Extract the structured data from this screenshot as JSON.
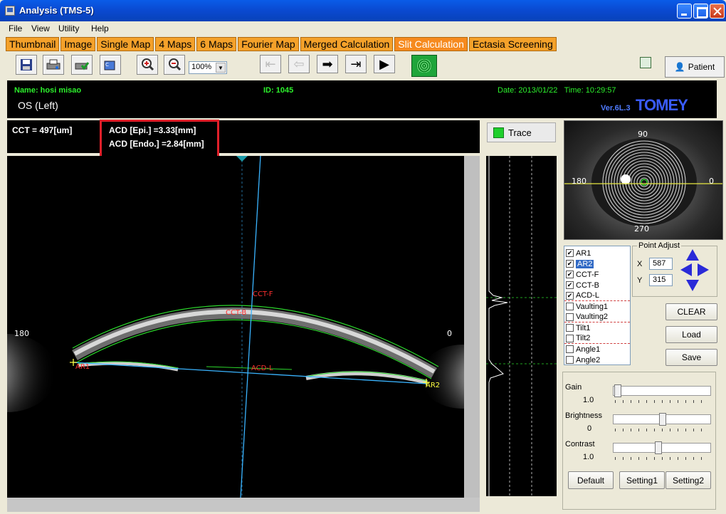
{
  "window": {
    "title": "Analysis (TMS-5)"
  },
  "menu": [
    "File",
    "View",
    "Utility",
    "Help"
  ],
  "tabs": [
    "Thumbnail",
    "Image",
    "Single Map",
    "4 Maps",
    "6 Maps",
    "Fourier Map",
    "Merged Calculation",
    "Slit Calculation",
    "Ectasia Screening"
  ],
  "active_tab": "Slit Calculation",
  "toolbar": {
    "zoom": "100%",
    "patient_label": "Patient"
  },
  "patient": {
    "name": "Name: hosi misao",
    "id": "ID: 1045",
    "eye": "OS (Left)",
    "date": "Date: 2013/01/22",
    "time": "Time: 10:29:57",
    "version": "Ver.6L.3",
    "brand": "TOMEY"
  },
  "measurements": {
    "cct": "CCT = 497[um]",
    "acd_epi": "ACD [Epi.]  =3.33[mm]",
    "acd_endo": "ACD [Endo.] =2.84[mm]"
  },
  "slit_image": {
    "label_left": "180",
    "label_right": "0",
    "markers": [
      "CCT-F",
      "CCT-B",
      "ACD-L",
      "AR1",
      "AR2"
    ]
  },
  "trace": {
    "label": "Trace"
  },
  "eye_thumb": {
    "label_top": "90",
    "label_left": "180",
    "label_right": "0",
    "label_bottom": "270"
  },
  "points": [
    {
      "label": "AR1",
      "checked": true
    },
    {
      "label": "AR2",
      "checked": true,
      "selected": true
    },
    {
      "label": "CCT-F",
      "checked": true
    },
    {
      "label": "CCT-B",
      "checked": true
    },
    {
      "label": "ACD-L",
      "checked": true
    },
    {
      "label": "Vaulting1",
      "checked": false
    },
    {
      "label": "Vaulting2",
      "checked": false
    },
    {
      "label": "Tilt1",
      "checked": false
    },
    {
      "label": "Tilt2",
      "checked": false
    },
    {
      "label": "Angle1",
      "checked": false
    },
    {
      "label": "Angle2",
      "checked": false
    }
  ],
  "point_adjust": {
    "title": "Point Adjust",
    "x_label": "X",
    "y_label": "Y",
    "x": "587",
    "y": "315"
  },
  "buttons": {
    "clear": "CLEAR",
    "load": "Load",
    "save": "Save",
    "default": "Default",
    "setting1": "Setting1",
    "setting2": "Setting2"
  },
  "sliders": [
    {
      "label": "Gain",
      "value": "1.0",
      "level": 0.0
    },
    {
      "label": "Brightness",
      "value": "0",
      "level": 0.5
    },
    {
      "label": "Contrast",
      "value": "1.0",
      "level": 0.45
    }
  ]
}
